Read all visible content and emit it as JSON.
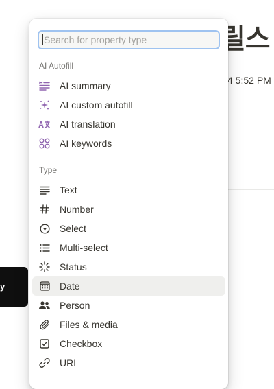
{
  "background": {
    "title_fragment": "릴스",
    "time_fragment": "4 5:52 PM",
    "tooltip_fragment": "y"
  },
  "menu": {
    "search": {
      "placeholder": "Search for property type",
      "value": ""
    },
    "ai_section": {
      "label": "AI Autofill",
      "items": [
        {
          "label": "AI summary",
          "icon": "ai-summary-icon"
        },
        {
          "label": "AI custom autofill",
          "icon": "sparkle-icon"
        },
        {
          "label": "AI translation",
          "icon": "translate-icon"
        },
        {
          "label": "AI keywords",
          "icon": "keywords-icon"
        }
      ]
    },
    "type_section": {
      "label": "Type",
      "items": [
        {
          "label": "Text",
          "icon": "text-lines-icon"
        },
        {
          "label": "Number",
          "icon": "hash-icon"
        },
        {
          "label": "Select",
          "icon": "select-icon"
        },
        {
          "label": "Multi-select",
          "icon": "list-icon"
        },
        {
          "label": "Status",
          "icon": "status-icon"
        },
        {
          "label": "Date",
          "icon": "calendar-icon",
          "selected": true
        },
        {
          "label": "Person",
          "icon": "people-icon"
        },
        {
          "label": "Files & media",
          "icon": "paperclip-icon"
        },
        {
          "label": "Checkbox",
          "icon": "checkbox-icon"
        },
        {
          "label": "URL",
          "icon": "link-icon"
        }
      ]
    }
  },
  "colors": {
    "accent_ai": "#9065b0",
    "text": "#37352f",
    "muted": "#787774",
    "selected_bg": "#efefed",
    "focus_ring": "#9fc3f0"
  }
}
